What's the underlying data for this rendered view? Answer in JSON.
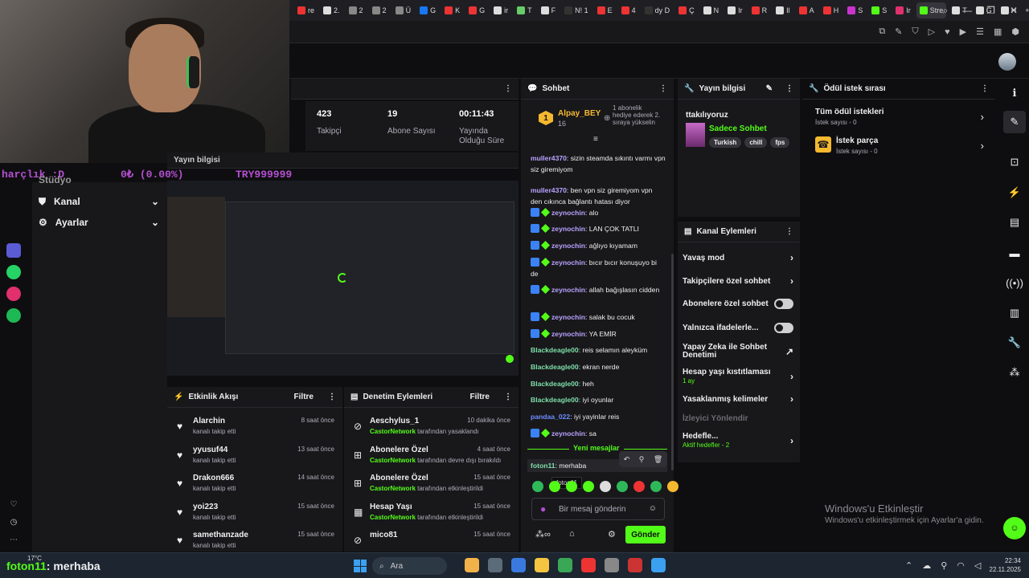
{
  "browser": {
    "tabs": [
      {
        "label": "re",
        "color": "#e33"
      },
      {
        "label": "2.",
        "color": "#ddd"
      },
      {
        "label": "2",
        "color": "#888"
      },
      {
        "label": "2",
        "color": "#888"
      },
      {
        "label": "Ü",
        "color": "#888"
      },
      {
        "label": "G",
        "color": "#1877f2"
      },
      {
        "label": "K",
        "color": "#e33"
      },
      {
        "label": "G",
        "color": "#e33"
      },
      {
        "label": "ir",
        "color": "#ddd"
      },
      {
        "label": "T",
        "color": "#6c6"
      },
      {
        "label": "F",
        "color": "#ddd"
      },
      {
        "label": "N! 1",
        "color": "#333"
      },
      {
        "label": "E",
        "color": "#e33"
      },
      {
        "label": "4",
        "color": "#e33"
      },
      {
        "label": "dy D",
        "color": "#333"
      },
      {
        "label": "Ç",
        "color": "#e33"
      },
      {
        "label": "N",
        "color": "#ddd"
      },
      {
        "label": "Ir",
        "color": "#ddd"
      },
      {
        "label": "R",
        "color": "#e33"
      },
      {
        "label": "Il",
        "color": "#ddd"
      },
      {
        "label": "A",
        "color": "#e33"
      },
      {
        "label": "H",
        "color": "#e33"
      },
      {
        "label": "S",
        "color": "#c3c"
      },
      {
        "label": "S",
        "color": "#53fc18"
      },
      {
        "label": "Ir",
        "color": "#e1306c"
      },
      {
        "label": "Stre",
        "color": "#53fc18"
      },
      {
        "label": "T",
        "color": "#ddd"
      },
      {
        "label": "G",
        "color": "#ddd"
      },
      {
        "label": "H",
        "color": "#ddd"
      }
    ],
    "active_tab_index": 25,
    "new_tab": "+",
    "win_controls": [
      "⌕",
      "—",
      "❐",
      "✕"
    ],
    "toolbar_icons": [
      "⧉",
      "✎",
      "⛉",
      "▷",
      "♥",
      "▶",
      "☰",
      "▦",
      "⬢"
    ]
  },
  "ticker": {
    "left": "harçlık :D",
    "middle": "0₺ (0.00%)",
    "right": "TRY999999"
  },
  "sidebar": {
    "partial_item": "Stüdyo",
    "items": [
      {
        "label": "Kanal",
        "icon": "⛊"
      },
      {
        "label": "Ayarlar",
        "icon": "⚙"
      }
    ],
    "rail_colors": [
      "#5b5bd6",
      "#25d366",
      "#e1306c",
      "#1db954"
    ],
    "bottom_icons": [
      "♡",
      "◷",
      "⋯"
    ]
  },
  "stats": {
    "partial_label": "Yayın bilgisi",
    "items": [
      {
        "value": "423",
        "label": "Takipçi"
      },
      {
        "value": "19",
        "label": "Abone Sayısı"
      },
      {
        "value": "00:11:43",
        "label": "Yayında Olduğu Süre"
      }
    ]
  },
  "activity": {
    "title": "Etkinlik Akışı",
    "filter": "Filtre",
    "rows": [
      {
        "name": "Alarchin",
        "sub": "kanalı takip etti",
        "time": "8 saat önce"
      },
      {
        "name": "yyusuf44",
        "sub": "kanalı takip etti",
        "time": "13 saat önce"
      },
      {
        "name": "Drakon666",
        "sub": "kanalı takip etti",
        "time": "14 saat önce"
      },
      {
        "name": "yoi223",
        "sub": "kanalı takip etti",
        "time": "15 saat önce"
      },
      {
        "name": "samethanzade",
        "sub": "kanalı takip etti",
        "time": "15 saat önce"
      }
    ]
  },
  "moderation": {
    "title": "Denetim Eylemleri",
    "filter": "Filtre",
    "rows": [
      {
        "name": "Aeschylus_1",
        "actor": "CastorNetwork",
        "sub": " tarafından yasaklandı",
        "time": "10 dakika önce",
        "icon": "⊘"
      },
      {
        "name": "Abonelere Özel",
        "actor": "CastorNetwork",
        "sub": " tarafından devre dışı bırakıldı",
        "time": "4 saat önce",
        "icon": "⊞"
      },
      {
        "name": "Abonelere Özel",
        "actor": "CastorNetwork",
        "sub": " tarafından etkinleştirildi",
        "time": "15 saat önce",
        "icon": "⊞"
      },
      {
        "name": "Hesap Yaşı",
        "actor": "CastorNetwork",
        "sub": " tarafından etkinleştirildi",
        "time": "15 saat önce",
        "icon": "▦"
      },
      {
        "name": "mico81",
        "actor": "",
        "sub": "",
        "time": "15 saat önce",
        "icon": "⊘"
      }
    ]
  },
  "chat": {
    "title": "Sohbet",
    "leader": {
      "rank": "1",
      "name": "Alpay_BEY",
      "count": "16",
      "note": "1 abonelik hediye ederek 2. sıraya yükselin"
    },
    "messages": [
      {
        "user": "muller4370",
        "text": ": sizin steamda sıkıntı varmı vpn siz giremiyom",
        "color": "#b9a3ff",
        "badges": false
      },
      {
        "user": "muller4370",
        "text": ": ben vpn siz giremiyom vpn den cıkınca bağlantı hatası diyor",
        "color": "#b9a3ff",
        "badges": false
      },
      {
        "user": "zeynochin",
        "text": ": alo",
        "color": "#b9a3ff",
        "badges": true
      },
      {
        "user": "zeynochin",
        "text": ": LAN ÇOK TATLI",
        "color": "#b9a3ff",
        "badges": true
      },
      {
        "user": "zeynochin",
        "text": ": ağlıyo kıyamam",
        "color": "#b9a3ff",
        "badges": true
      },
      {
        "user": "zeynochin",
        "text": ": bıcır bıcır konuşuyo bi de",
        "color": "#b9a3ff",
        "badges": true
      },
      {
        "user": "zeynochin",
        "text": ": allah bağışlasın cidden",
        "color": "#b9a3ff",
        "badges": true
      },
      {
        "user": "zeynochin",
        "text": ": salak bu cocuk",
        "color": "#b9a3ff",
        "badges": true
      },
      {
        "user": "zeynochin",
        "text": ": YA EMİR",
        "color": "#b9a3ff",
        "badges": true
      },
      {
        "user": "Blackdeagle00",
        "text": ": reis selamın aleyküm",
        "color": "#7ee0a8",
        "badges": false
      },
      {
        "user": "Blackdeagle00",
        "text": ": ekran nerde",
        "color": "#7ee0a8",
        "badges": false
      },
      {
        "user": "Blackdeagle00",
        "text": ": heh",
        "color": "#7ee0a8",
        "badges": false
      },
      {
        "user": "Blackdeagle00",
        "text": ": iyi oyunlar",
        "color": "#7ee0a8",
        "badges": false
      },
      {
        "user": "pandaa_022",
        "text": ": iyi yayinlar reis",
        "color": "#6e8cff",
        "badges": false
      },
      {
        "user": "zeynochin",
        "text": ": sa",
        "color": "#b9a3ff",
        "badges": true
      }
    ],
    "new_messages": "Yeni mesajlar",
    "last": {
      "user": "foton11",
      "text": ": merhaba"
    },
    "tooltip": "foton11",
    "placeholder": "Bir mesaj gönderin",
    "send": "Gönder"
  },
  "stream_info": {
    "title": "Yayın bilgisi",
    "stream_title": "ttakılıyoruz",
    "category": "Sadece Sohbet",
    "tags": [
      "Turkish",
      "chill",
      "fps"
    ]
  },
  "channel_actions": {
    "title": "Kanal Eylemleri",
    "rows": [
      {
        "label": "Yavaş mod",
        "type": "chev"
      },
      {
        "label": "Takipçilere özel sohbet",
        "type": "chev"
      },
      {
        "label": "Abonelere özel sohbet",
        "type": "toggle"
      },
      {
        "label": "Yalnızca ifadelerle...",
        "type": "toggle"
      },
      {
        "label": "Yapay Zeka ile Sohbet Denetimi",
        "type": "ext"
      },
      {
        "label": "Hesap yaşı kıstıtlaması",
        "sub": "1 ay",
        "type": "chev"
      },
      {
        "label": "Yasaklanmış kelimeler",
        "type": "chev"
      },
      {
        "label": "İzleyici Yönlendir",
        "type": "none"
      },
      {
        "label": "Hedefle...",
        "sub": "Aktif hedefler - 2",
        "type": "chev"
      }
    ]
  },
  "rewards": {
    "title": "Ödül istek sırası",
    "rows": [
      {
        "label": "Tüm ödül istekleri",
        "sub": "İstek sayısı - 0"
      },
      {
        "label": "İstek parça",
        "sub": "İstek sayısı - 0"
      }
    ]
  },
  "watermark": {
    "line1": "Windows'u Etkinleştir",
    "line2": "Windows'u etkinleştirmek için Ayarlar'a gidin."
  },
  "overlay_chat": {
    "user": "foton11",
    "text": " : merhaba",
    "weather": "17°C"
  },
  "taskbar": {
    "search": "Ara",
    "time": "22:34",
    "date": "22.11.2025"
  },
  "colors": {
    "accent": "#53fc18",
    "bg": "#0e0e10",
    "panel": "#18181b"
  }
}
